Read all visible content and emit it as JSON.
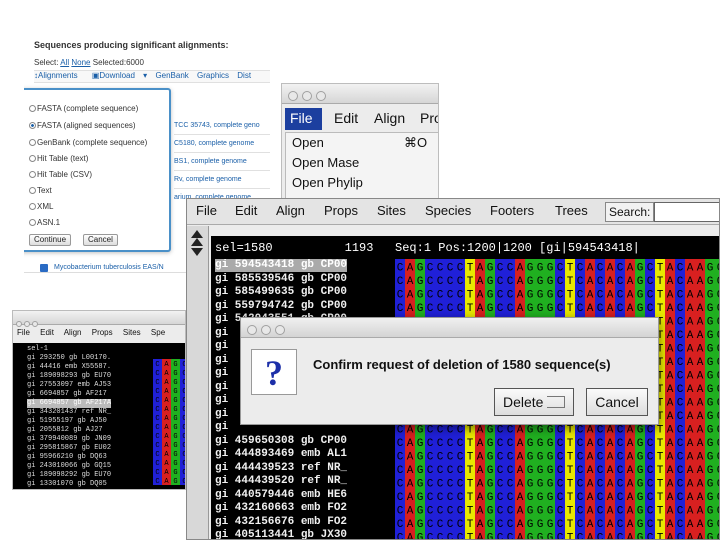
{
  "blast": {
    "title": "Sequences producing significant alignments:",
    "select_label": "Select:",
    "select_all": "All",
    "select_none": "None",
    "selected_label": "Selected:6000",
    "toolbar": [
      "Alignments",
      "Download",
      "GenBank",
      "Graphics",
      "Dist"
    ],
    "hits": [
      "TCC 35743, complete geno",
      "C5180, complete genome",
      "BS1, complete genome",
      "Rv, complete genome",
      "arium, complete genome"
    ],
    "download_options": [
      {
        "label": "FASTA (complete sequence)",
        "selected": false
      },
      {
        "label": "FASTA (aligned sequences)",
        "selected": true
      },
      {
        "label": "GenBank (complete sequence)",
        "selected": false
      },
      {
        "label": "Hit Table (text)",
        "selected": false
      },
      {
        "label": "Hit Table (CSV)",
        "selected": false
      },
      {
        "label": "Text",
        "selected": false
      },
      {
        "label": "XML",
        "selected": false
      },
      {
        "label": "ASN.1",
        "selected": false
      }
    ],
    "continue_label": "Continue",
    "cancel_label": "Cancel",
    "bottom_hit": "Mycobacterium tuberculosis EAS/N"
  },
  "file_window": {
    "menus": [
      "File",
      "Edit",
      "Align",
      "Pro"
    ],
    "items": [
      "Open",
      "Open Mase",
      "Open Phylip"
    ],
    "open_shortcut": "⌘O"
  },
  "small_window": {
    "menus": [
      "File",
      "Edit",
      "Align",
      "Props",
      "Sites",
      "Spe"
    ],
    "rows": [
      "sel-1",
      "gi 293250 gb L00170.",
      "gi 44416 emb X55587.",
      "gi 189098293 gb EU70",
      "gi 27553097 emb AJ53",
      "gi 6694857 gb AF217",
      "gi 6694857 gb AF217A",
      "gi 343201437 ref NR_",
      "gi 51955197 gb AJ50",
      "gi 2055812 gb AJ27",
      "gi 379940089 gb JN09",
      "gi 295815867 gb EU02",
      "gi 95966210 gb DQ63",
      "gi 243010066 gb GQ15",
      "gi 189098292 gb EU70",
      "gi 13301070 gb DQ05"
    ]
  },
  "seaview": {
    "menus": [
      "File",
      "Edit",
      "Align",
      "Props",
      "Sites",
      "Species",
      "Footers",
      "Trees"
    ],
    "search_label": "Search:",
    "info_line": "sel=1580          1193   Seq:1 Pos:1200|1200 [gi|594543418|",
    "rows": [
      "gi 594543418 gb CP00",
      "gi 585539546 gb CP00",
      "gi 585499635 gb CP00",
      "gi 559794742 gb CP00",
      "gi 542043551 gb CP00",
      "gi",
      "gi",
      "gi",
      "gi",
      "gi",
      "gi",
      "gi",
      "gi",
      "gi 459650308 gb CP00",
      "gi 444893469 emb AL1",
      "gi 444439523 ref NR_",
      "gi 444439520 ref NR_",
      "gi 440579446 emb HE6",
      "gi 432160663 emb FO2",
      "gi 432156676 emb FO2",
      "gi 405113441 gb JX30"
    ],
    "sequence": "CAGCCCCTAGCCAGGGCTCACACAGCTACAAGG",
    "nucleotide_colors": {
      "A": "#d82020",
      "C": "#2020d8",
      "G": "#20b020",
      "T": "#e8e800"
    }
  },
  "dialog": {
    "icon": "?",
    "message": "Confirm request of deletion of 1580 sequence(s)",
    "delete_label": "Delete",
    "cancel_label": "Cancel"
  }
}
